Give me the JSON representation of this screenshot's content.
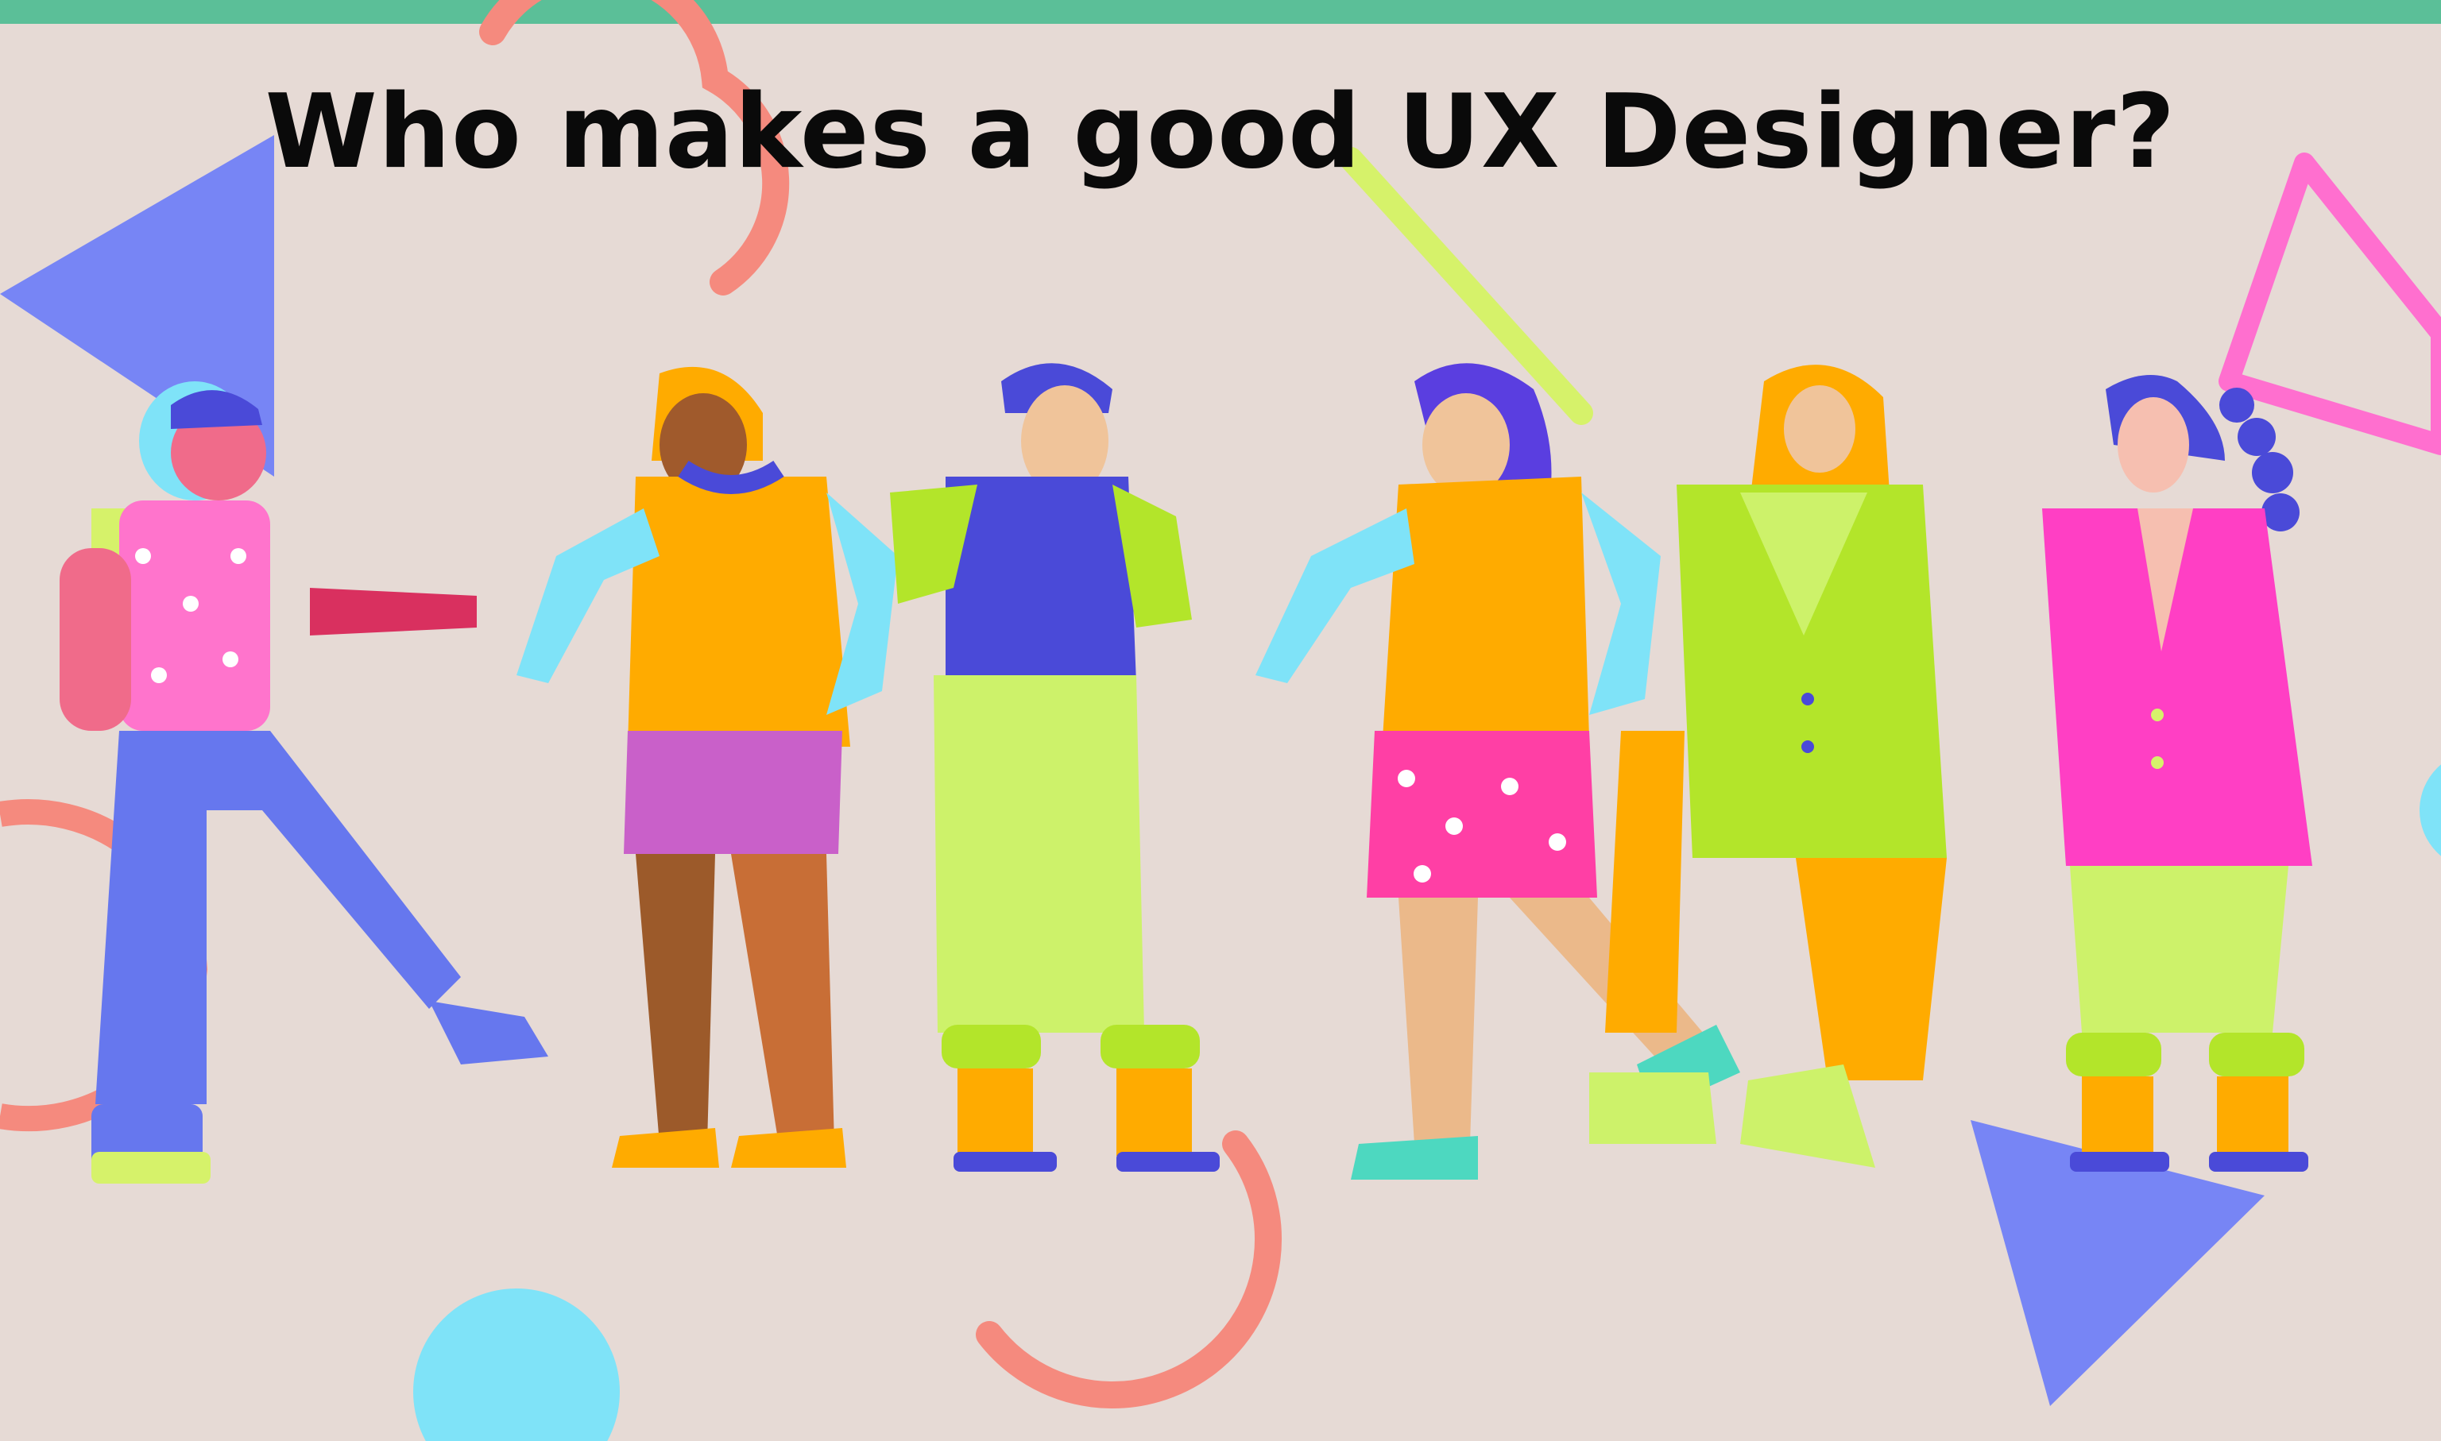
{
  "page": {
    "title": "Who makes a good UX Designer?"
  },
  "colors": {
    "background": "#e6dad5",
    "top_bar": "#5bbf98",
    "title_text": "#0a0a0a",
    "blue_shape": "#7785f5",
    "coral_ring": "#f58a7e",
    "lime_line": "#d6f26a",
    "pink_outline": "#ff6fcf",
    "cyan_circle": "#7fe3f8"
  },
  "illustration": {
    "figure_count": 6,
    "figures": [
      "figure-cap-floral-vest",
      "figure-orange-top-purple-shorts",
      "figure-beret-varsity-shirt",
      "figure-floral-shorts",
      "figure-hijab-green-blazer",
      "figure-pink-blazer"
    ]
  }
}
